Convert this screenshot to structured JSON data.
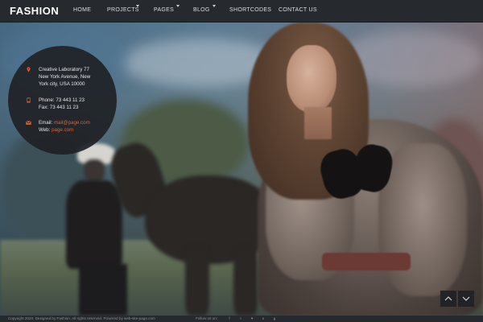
{
  "header": {
    "logo": "FASHION",
    "nav": [
      {
        "label": "HOME",
        "has_dropdown": false
      },
      {
        "label": "PROJECTS",
        "has_dropdown": true
      },
      {
        "label": "PAGES",
        "has_dropdown": true
      },
      {
        "label": "BLOG",
        "has_dropdown": true
      },
      {
        "label": "SHORTCODES",
        "has_dropdown": false
      },
      {
        "label": "CONTACT US",
        "has_dropdown": false
      }
    ]
  },
  "contact": {
    "address_line1": "Creative Laboratory 77",
    "address_line2": "New York Avenue, New",
    "address_line3": "York city, USA 10000",
    "phone": "Phone: 73 443 11 23",
    "fax": "Fax: 73 443 11 23",
    "email_label": "Email:",
    "email": "mail@page.com",
    "web_label": "Web:",
    "web": "page.com",
    "icons": [
      "map-pin-icon",
      "phone-icon",
      "mail-icon"
    ]
  },
  "slider": {
    "prev_icon": "chevron-up-icon",
    "next_icon": "chevron-down-icon"
  },
  "footer": {
    "copyright": "Copyright 2020. Designed by Fashion. All rights reserved. Powered by web-site-page.com",
    "follow_label": "Follow us on:",
    "social_icons": [
      "facebook-icon",
      "pinterest-icon",
      "twitter-icon",
      "vimeo-icon",
      "google-plus-icon"
    ]
  },
  "colors": {
    "accent": "#d8623a",
    "header_bg": "#26292d",
    "panel_bg": "#202226"
  }
}
